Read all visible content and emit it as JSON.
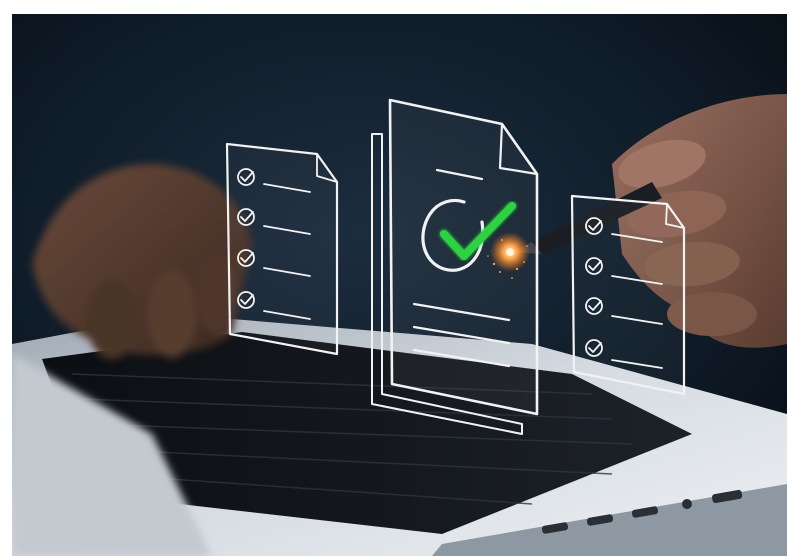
{
  "scene": {
    "subject": "hands-using-laptop-with-holographic-checklist-documents",
    "colors": {
      "background": "#0d1a26",
      "laptop_silver": "#c9d0d8",
      "keyboard": "#15181d",
      "hologram_line": "#f2f2f2",
      "check_green": "#2bd43f",
      "spark_orange": "#ff7a1a"
    },
    "icons": {
      "main_document": "document-with-checkmark-icon",
      "left_checklist": "checklist-icon",
      "right_checklist": "checklist-icon"
    }
  }
}
